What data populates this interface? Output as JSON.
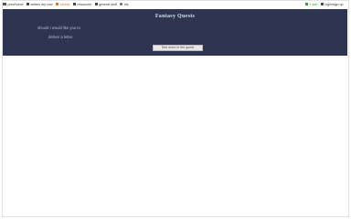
{
  "nav": {
    "left": [
      {
        "label": "prev/home",
        "icon": "home-icon"
      },
      {
        "label": "writers dry cow",
        "icon": "writers-icon"
      },
      {
        "label": "tutorial",
        "icon": "tutorial-icon",
        "accent": "#e07020"
      },
      {
        "label": "resources",
        "icon": "resources-icon"
      },
      {
        "label": "general stuff",
        "icon": "general-icon"
      },
      {
        "label": "etc",
        "icon": "etc-icon"
      }
    ],
    "right": [
      {
        "label": "+ add",
        "icon": "plus-icon",
        "accent": "#2e9a3a"
      },
      {
        "label": "login/sign up",
        "icon": "user-icon"
      }
    ]
  },
  "banner": {
    "title": "Fantasy Quests",
    "line1": "should I would like you to",
    "line2": "deliver a letter.",
    "button": "See more in the quest"
  },
  "colors": {
    "banner_bg": "#2f3551",
    "title": "#cfe0ef",
    "accent_orange": "#e07020",
    "accent_green": "#2e9a3a"
  }
}
